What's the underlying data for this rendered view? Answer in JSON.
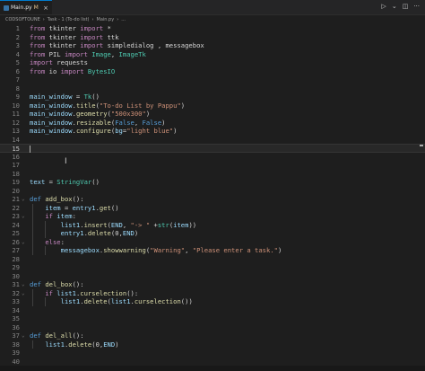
{
  "tab": {
    "label": "Main.py",
    "modified": "M"
  },
  "actions": {
    "run": "▷",
    "dropdown": "⌄",
    "split": "◫",
    "more": "···"
  },
  "breadcrumb": [
    "CODSOFTOUNE",
    "Task - 1 (To-do list)",
    "Main.py",
    "..."
  ],
  "current_line": 15,
  "lines": [
    {
      "n": "1",
      "t": [
        [
          "kw",
          "from "
        ],
        [
          "",
          "tkinter "
        ],
        [
          "kw",
          "import "
        ],
        [
          "",
          "*"
        ]
      ]
    },
    {
      "n": "2",
      "t": [
        [
          "kw",
          "from "
        ],
        [
          "",
          "tkinter "
        ],
        [
          "kw",
          "import "
        ],
        [
          "",
          "ttk"
        ]
      ]
    },
    {
      "n": "3",
      "t": [
        [
          "kw",
          "from "
        ],
        [
          "",
          "tkinter "
        ],
        [
          "kw",
          "import "
        ],
        [
          "",
          "simpledialog , messagebox"
        ]
      ]
    },
    {
      "n": "4",
      "t": [
        [
          "kw",
          "from "
        ],
        [
          "",
          "PIL "
        ],
        [
          "kw",
          "import "
        ],
        [
          "cls",
          "Image"
        ],
        [
          "",
          ", "
        ],
        [
          "cls",
          "ImageTk"
        ]
      ]
    },
    {
      "n": "5",
      "t": [
        [
          "kw",
          "import "
        ],
        [
          "",
          "requests"
        ]
      ]
    },
    {
      "n": "6",
      "t": [
        [
          "kw",
          "from "
        ],
        [
          "",
          "io "
        ],
        [
          "kw",
          "import "
        ],
        [
          "cls",
          "BytesIO"
        ]
      ]
    },
    {
      "n": "7",
      "t": []
    },
    {
      "n": "8",
      "t": []
    },
    {
      "n": "9",
      "t": [
        [
          "var",
          "main_window"
        ],
        [
          "",
          " = "
        ],
        [
          "cls",
          "Tk"
        ],
        [
          "",
          "()"
        ]
      ]
    },
    {
      "n": "10",
      "t": [
        [
          "var",
          "main_window"
        ],
        [
          "",
          "."
        ],
        [
          "fn",
          "title"
        ],
        [
          "",
          "("
        ],
        [
          "str",
          "\"To-do List by Pappu\""
        ],
        [
          "",
          ")"
        ]
      ]
    },
    {
      "n": "11",
      "t": [
        [
          "var",
          "main_window"
        ],
        [
          "",
          "."
        ],
        [
          "fn",
          "geometry"
        ],
        [
          "",
          "("
        ],
        [
          "str",
          "\"500x300\""
        ],
        [
          "",
          ")"
        ]
      ]
    },
    {
      "n": "12",
      "t": [
        [
          "var",
          "main_window"
        ],
        [
          "",
          "."
        ],
        [
          "fn",
          "resizable"
        ],
        [
          "",
          "("
        ],
        [
          "kw2",
          "False"
        ],
        [
          "",
          ", "
        ],
        [
          "kw2",
          "False"
        ],
        [
          "",
          ")"
        ]
      ]
    },
    {
      "n": "13",
      "t": [
        [
          "var",
          "main_window"
        ],
        [
          "",
          "."
        ],
        [
          "fn",
          "configure"
        ],
        [
          "",
          "("
        ],
        [
          "var",
          "bg"
        ],
        [
          "",
          "="
        ],
        [
          "str",
          "\"light blue\""
        ],
        [
          "",
          ")"
        ]
      ]
    },
    {
      "n": "14",
      "t": []
    },
    {
      "n": "15",
      "t": []
    },
    {
      "n": "16",
      "t": []
    },
    {
      "n": "17",
      "t": []
    },
    {
      "n": "18",
      "t": []
    },
    {
      "n": "19",
      "t": [
        [
          "var",
          "text"
        ],
        [
          "",
          " = "
        ],
        [
          "cls",
          "StringVar"
        ],
        [
          "",
          "()"
        ]
      ]
    },
    {
      "n": "20",
      "t": []
    },
    {
      "n": "21",
      "t": [
        [
          "kw2",
          "def "
        ],
        [
          "fn",
          "add_box"
        ],
        [
          "",
          "():"
        ]
      ],
      "fold": true
    },
    {
      "n": "22",
      "t": [
        [
          "",
          "    "
        ],
        [
          "var",
          "item"
        ],
        [
          "",
          " = "
        ],
        [
          "var",
          "entry1"
        ],
        [
          "",
          "."
        ],
        [
          "fn",
          "get"
        ],
        [
          "",
          "()"
        ]
      ]
    },
    {
      "n": "23",
      "t": [
        [
          "",
          "    "
        ],
        [
          "kw",
          "if "
        ],
        [
          "var",
          "item"
        ],
        [
          "",
          ":"
        ]
      ],
      "fold": true
    },
    {
      "n": "24",
      "t": [
        [
          "",
          "        "
        ],
        [
          "var",
          "list1"
        ],
        [
          "",
          "."
        ],
        [
          "fn",
          "insert"
        ],
        [
          "",
          "("
        ],
        [
          "var",
          "END"
        ],
        [
          "",
          ", "
        ],
        [
          "str",
          "\"-> \""
        ],
        [
          "",
          " +"
        ],
        [
          "cls",
          "str"
        ],
        [
          "",
          "("
        ],
        [
          "var",
          "item"
        ],
        [
          "",
          "))"
        ]
      ]
    },
    {
      "n": "25",
      "t": [
        [
          "",
          "        "
        ],
        [
          "var",
          "entry1"
        ],
        [
          "",
          "."
        ],
        [
          "fn",
          "delete"
        ],
        [
          "",
          "("
        ],
        [
          "",
          "0,"
        ],
        [
          "var",
          "END"
        ],
        [
          "",
          ")"
        ]
      ]
    },
    {
      "n": "26",
      "t": [
        [
          "",
          "    "
        ],
        [
          "kw",
          "else"
        ],
        [
          "",
          ":"
        ]
      ],
      "fold": true
    },
    {
      "n": "27",
      "t": [
        [
          "",
          "        "
        ],
        [
          "var",
          "messagebox"
        ],
        [
          "",
          "."
        ],
        [
          "fn",
          "showwarning"
        ],
        [
          "",
          "("
        ],
        [
          "str",
          "\"Warning\""
        ],
        [
          "",
          ", "
        ],
        [
          "str",
          "\"Please enter a task.\""
        ],
        [
          "",
          ")"
        ]
      ]
    },
    {
      "n": "28",
      "t": []
    },
    {
      "n": "29",
      "t": []
    },
    {
      "n": "30",
      "t": []
    },
    {
      "n": "31",
      "t": [
        [
          "kw2",
          "def "
        ],
        [
          "fn",
          "del_box"
        ],
        [
          "",
          "():"
        ]
      ],
      "fold": true
    },
    {
      "n": "32",
      "t": [
        [
          "",
          "    "
        ],
        [
          "kw",
          "if "
        ],
        [
          "var",
          "list1"
        ],
        [
          "",
          "."
        ],
        [
          "fn",
          "curselection"
        ],
        [
          "",
          "():"
        ]
      ],
      "fold": true
    },
    {
      "n": "33",
      "t": [
        [
          "",
          "        "
        ],
        [
          "var",
          "list1"
        ],
        [
          "",
          "."
        ],
        [
          "fn",
          "delete"
        ],
        [
          "",
          "("
        ],
        [
          "var",
          "list1"
        ],
        [
          "",
          "."
        ],
        [
          "fn",
          "curselection"
        ],
        [
          "",
          "())"
        ]
      ]
    },
    {
      "n": "34",
      "t": []
    },
    {
      "n": "35",
      "t": []
    },
    {
      "n": "36",
      "t": []
    },
    {
      "n": "37",
      "t": [
        [
          "kw2",
          "def "
        ],
        [
          "fn",
          "del_all"
        ],
        [
          "",
          "():"
        ]
      ],
      "fold": true
    },
    {
      "n": "38",
      "t": [
        [
          "",
          "    "
        ],
        [
          "var",
          "list1"
        ],
        [
          "",
          "."
        ],
        [
          "fn",
          "delete"
        ],
        [
          "",
          "("
        ],
        [
          "",
          "0,"
        ],
        [
          "var",
          "END"
        ],
        [
          "",
          ")"
        ]
      ]
    },
    {
      "n": "39",
      "t": []
    },
    {
      "n": "40",
      "t": []
    }
  ]
}
